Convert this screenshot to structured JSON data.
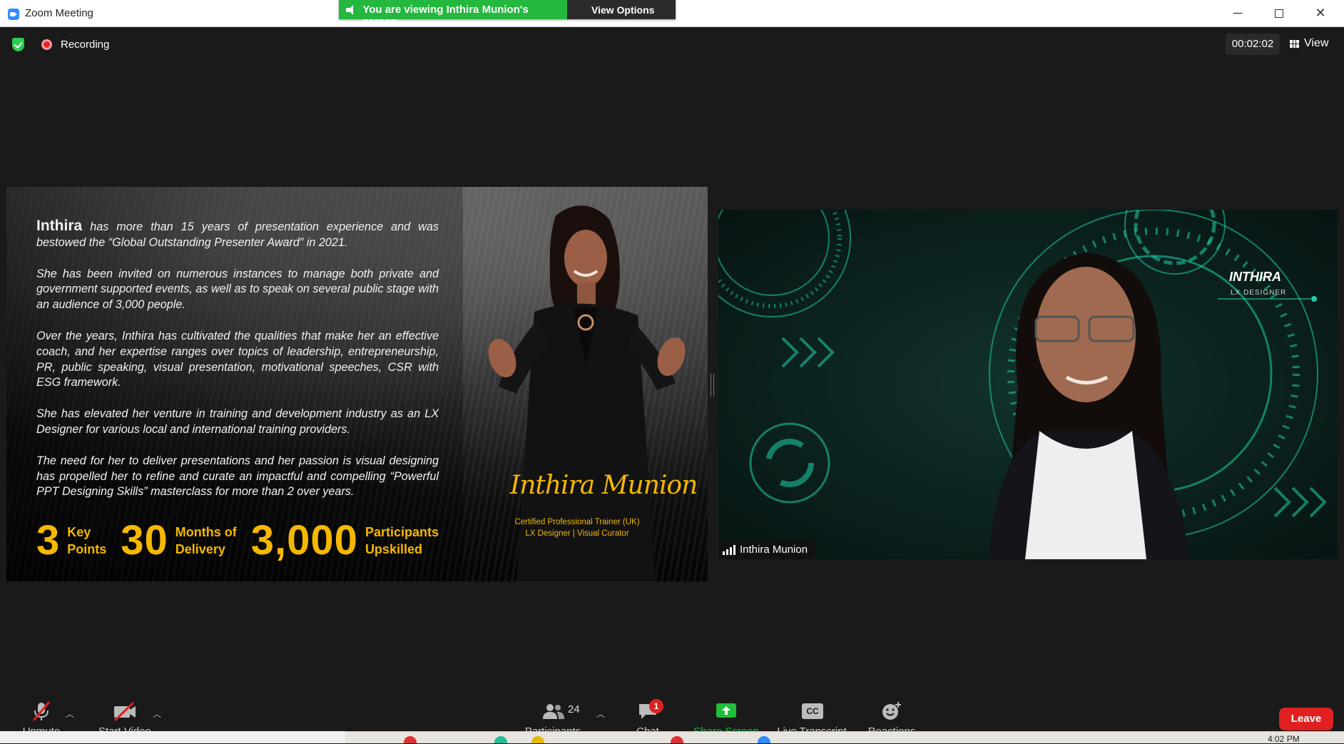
{
  "window": {
    "title": "Zoom Meeting",
    "minimize": "─",
    "close": "✕"
  },
  "banner": {
    "message": "You are viewing Inthira Munion's screen",
    "view_options": "View Options ⌄"
  },
  "meeting": {
    "recording_label": "Recording",
    "timer": "00:02:02",
    "view_label": "View"
  },
  "shared_screen": {
    "intro_name": "Inthira",
    "intro_rest": " has more than 15 years of presentation experience and was bestowed the “Global Outstanding Presenter Award” in 2021.",
    "paragraphs": [
      "She has been invited on numerous instances to manage both private and government supported events, as well as to speak on several public stage with an audience of 3,000 people.",
      "Over the years, Inthira has cultivated the qualities that make her an effective coach, and her expertise ranges over topics of leadership, entrepreneurship, PR, public speaking, visual presentation, motivational speeches, CSR with ESG framework.",
      "She has elevated her venture in training and development industry as an LX Designer for various local and international training providers.",
      "The need for her to deliver presentations and her passion is visual designing has propelled her to refine and curate an impactful and compelling “Powerful PPT Designing Skills” masterclass for more than 2 over years."
    ],
    "stats": [
      {
        "number": "3",
        "line1": "Key",
        "line2": "Points"
      },
      {
        "number": "30",
        "line1": "Months of",
        "line2": "Delivery"
      },
      {
        "number": "3,000",
        "line1": "Participants",
        "line2": "Upskilled"
      }
    ],
    "signature": "Inthira Munion",
    "cert_line1": "Certified Professional Trainer (UK)",
    "cert_line2": "LX Designer  |  Visual Curator"
  },
  "video": {
    "participant_name": "Inthira Munion",
    "bg_title": "INTHIRA",
    "bg_subtitle": "LX DESIGNER"
  },
  "toolbar": {
    "unmute": "Unmute",
    "start_video": "Start Video",
    "participants_count": "24",
    "participants": "Participants",
    "chat": "Chat",
    "chat_badge": "1",
    "share_screen": "Share Screen",
    "live_transcript": "Live Transcript",
    "cc": "CC",
    "reactions": "Reactions",
    "leave": "Leave"
  },
  "taskbar": {
    "clock": "4:02 PM"
  },
  "colors": {
    "zoom_blue": "#2d8cff",
    "banner_green": "#24b83f",
    "accent_gold": "#f5b800",
    "leave_red": "#e02020",
    "share_green": "#1fbf3a",
    "video_teal": "#1fd1a8"
  }
}
